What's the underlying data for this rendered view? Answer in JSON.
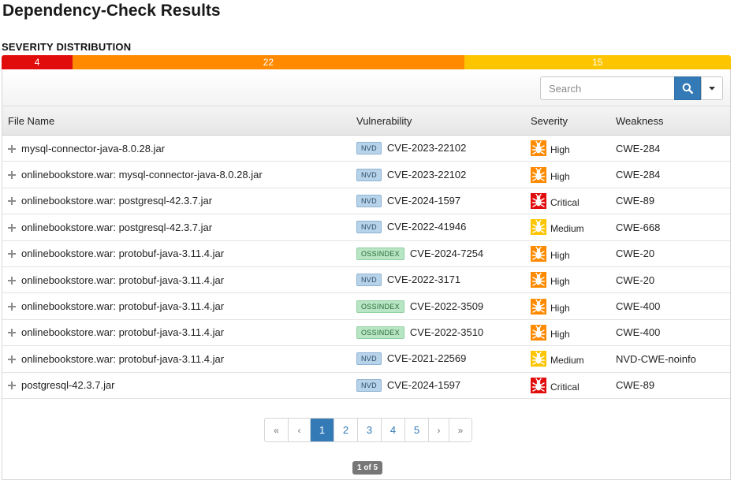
{
  "title": "Dependency-Check Results",
  "severity_distribution": {
    "heading": "SEVERITY DISTRIBUTION",
    "segments": [
      {
        "count": "4",
        "value": 4,
        "color": "#e10d0d"
      },
      {
        "count": "22",
        "value": 22,
        "color": "#ff8a00"
      },
      {
        "count": "15",
        "value": 15,
        "color": "#fcc500"
      }
    ]
  },
  "search": {
    "placeholder": "Search",
    "button_icon": "search-icon",
    "dropdown_icon": "caret-down-icon"
  },
  "table": {
    "columns": [
      "File Name",
      "Vulnerability",
      "Severity",
      "Weakness"
    ],
    "rows": [
      {
        "file": "mysql-connector-java-8.0.28.jar",
        "source": "NVD",
        "cve": "CVE-2023-22102",
        "severity": "High",
        "weakness": "CWE-284"
      },
      {
        "file": "onlinebookstore.war: mysql-connector-java-8.0.28.jar",
        "source": "NVD",
        "cve": "CVE-2023-22102",
        "severity": "High",
        "weakness": "CWE-284"
      },
      {
        "file": "onlinebookstore.war: postgresql-42.3.7.jar",
        "source": "NVD",
        "cve": "CVE-2024-1597",
        "severity": "Critical",
        "weakness": "CWE-89"
      },
      {
        "file": "onlinebookstore.war: postgresql-42.3.7.jar",
        "source": "NVD",
        "cve": "CVE-2022-41946",
        "severity": "Medium",
        "weakness": "CWE-668"
      },
      {
        "file": "onlinebookstore.war: protobuf-java-3.11.4.jar",
        "source": "OSSINDEX",
        "cve": "CVE-2024-7254",
        "severity": "High",
        "weakness": "CWE-20"
      },
      {
        "file": "onlinebookstore.war: protobuf-java-3.11.4.jar",
        "source": "NVD",
        "cve": "CVE-2022-3171",
        "severity": "High",
        "weakness": "CWE-20"
      },
      {
        "file": "onlinebookstore.war: protobuf-java-3.11.4.jar",
        "source": "OSSINDEX",
        "cve": "CVE-2022-3509",
        "severity": "High",
        "weakness": "CWE-400"
      },
      {
        "file": "onlinebookstore.war: protobuf-java-3.11.4.jar",
        "source": "OSSINDEX",
        "cve": "CVE-2022-3510",
        "severity": "High",
        "weakness": "CWE-400"
      },
      {
        "file": "onlinebookstore.war: protobuf-java-3.11.4.jar",
        "source": "NVD",
        "cve": "CVE-2021-22569",
        "severity": "Medium",
        "weakness": "NVD-CWE-noinfo"
      },
      {
        "file": "postgresql-42.3.7.jar",
        "source": "NVD",
        "cve": "CVE-2024-1597",
        "severity": "Critical",
        "weakness": "CWE-89"
      }
    ]
  },
  "severity_colors": {
    "Critical": "#e10d0d",
    "High": "#ff8a00",
    "Medium": "#fcc500"
  },
  "pagination": {
    "first": "«",
    "prev": "‹",
    "pages": [
      "1",
      "2",
      "3",
      "4",
      "5"
    ],
    "active_page": "1",
    "next": "›",
    "last": "»",
    "info": "1 of 5"
  }
}
